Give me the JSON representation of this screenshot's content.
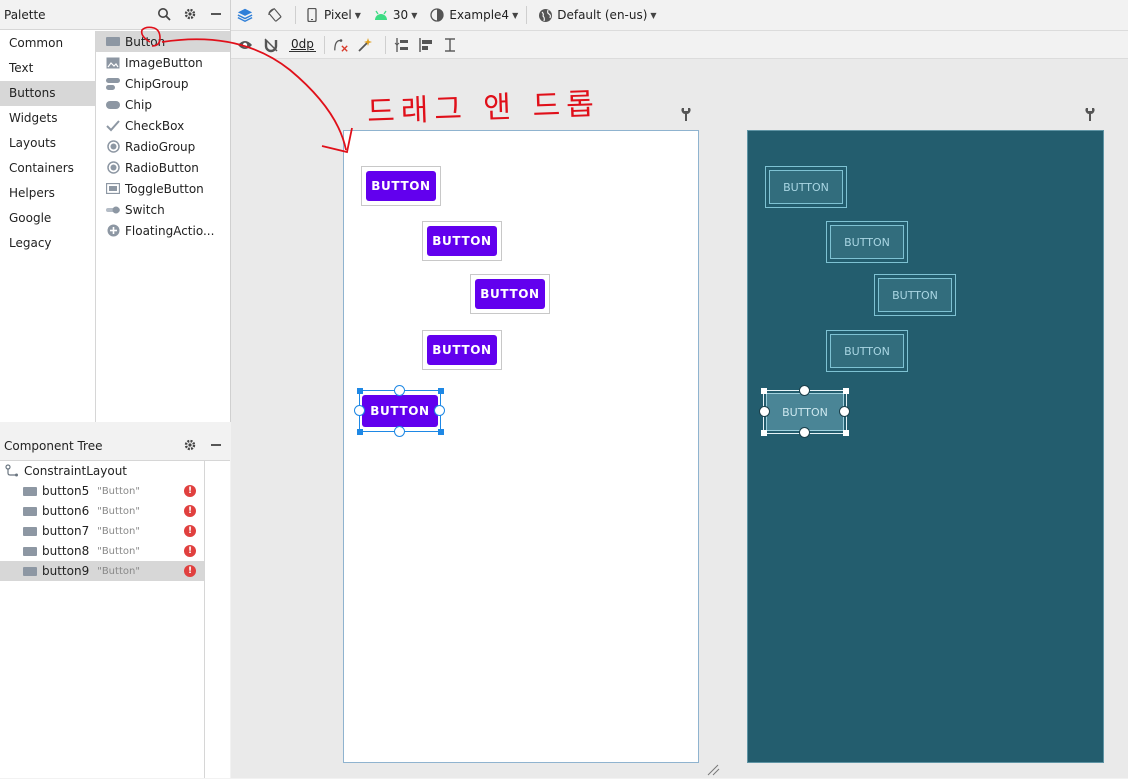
{
  "palette": {
    "title": "Palette",
    "categories": [
      "Common",
      "Text",
      "Buttons",
      "Widgets",
      "Layouts",
      "Containers",
      "Helpers",
      "Google",
      "Legacy"
    ],
    "items": [
      "Button",
      "ImageButton",
      "ChipGroup",
      "Chip",
      "CheckBox",
      "RadioGroup",
      "RadioButton",
      "ToggleButton",
      "Switch",
      "FloatingActio..."
    ]
  },
  "tree": {
    "title": "Component Tree",
    "root": "ConstraintLayout",
    "nodes": [
      {
        "name": "button5",
        "text": "\"Button\""
      },
      {
        "name": "button6",
        "text": "\"Button\""
      },
      {
        "name": "button7",
        "text": "\"Button\""
      },
      {
        "name": "button8",
        "text": "\"Button\""
      },
      {
        "name": "button9",
        "text": "\"Button\""
      }
    ]
  },
  "toolbar": {
    "device": "Pixel",
    "api": "30",
    "theme": "Example4",
    "locale": "Default (en-us)",
    "margin": "0dp"
  },
  "canvas": {
    "annotation": "드래그 앤 드롭",
    "button_label": "BUTTON",
    "blueprint_label": "BUTTON"
  },
  "colors": {
    "button": "#6200ee",
    "blueprint_bg": "#235d6e",
    "annotation": "#e0101a",
    "selection": "#1e88e5"
  }
}
